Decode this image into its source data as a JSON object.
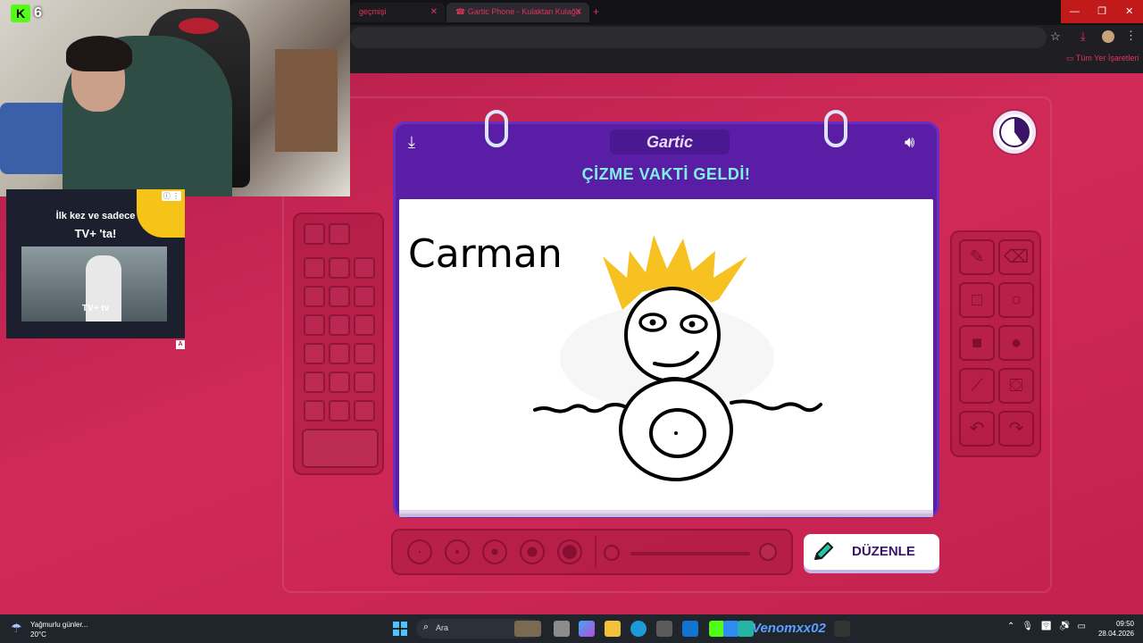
{
  "browser": {
    "tabs": [
      {
        "label": "geçmişi"
      },
      {
        "label": "Gartic Phone - Kulaktan Kulağa"
      }
    ],
    "bookmarks_label": "Tüm Yer İşaretleri"
  },
  "stream": {
    "viewer_count": "6",
    "platform_letter": "K"
  },
  "ad": {
    "line1": "İlk kez ve sadece",
    "line2": "TV+ 'ta!",
    "brand": "TV+ tv",
    "badge": "A"
  },
  "game": {
    "logo": "Gartic",
    "header_title": "ÇİZME VAKTİ GELDİ!",
    "canvas_text": "Carman",
    "edit_button_label": "DÜZENLE",
    "timer_fraction": 0.4
  },
  "colors": {
    "game_background": "#c8254f",
    "notebook": "#5a1ea6",
    "header_text": "#7ef0e6",
    "hair": "#f6c121"
  },
  "taskbar": {
    "weather_line1": "Yağmurlu günler...",
    "weather_line2": "20°C",
    "search_placeholder": "Ara",
    "streamer_name": "Venomxx02",
    "time": "09:50",
    "date": "28.04.2026"
  }
}
